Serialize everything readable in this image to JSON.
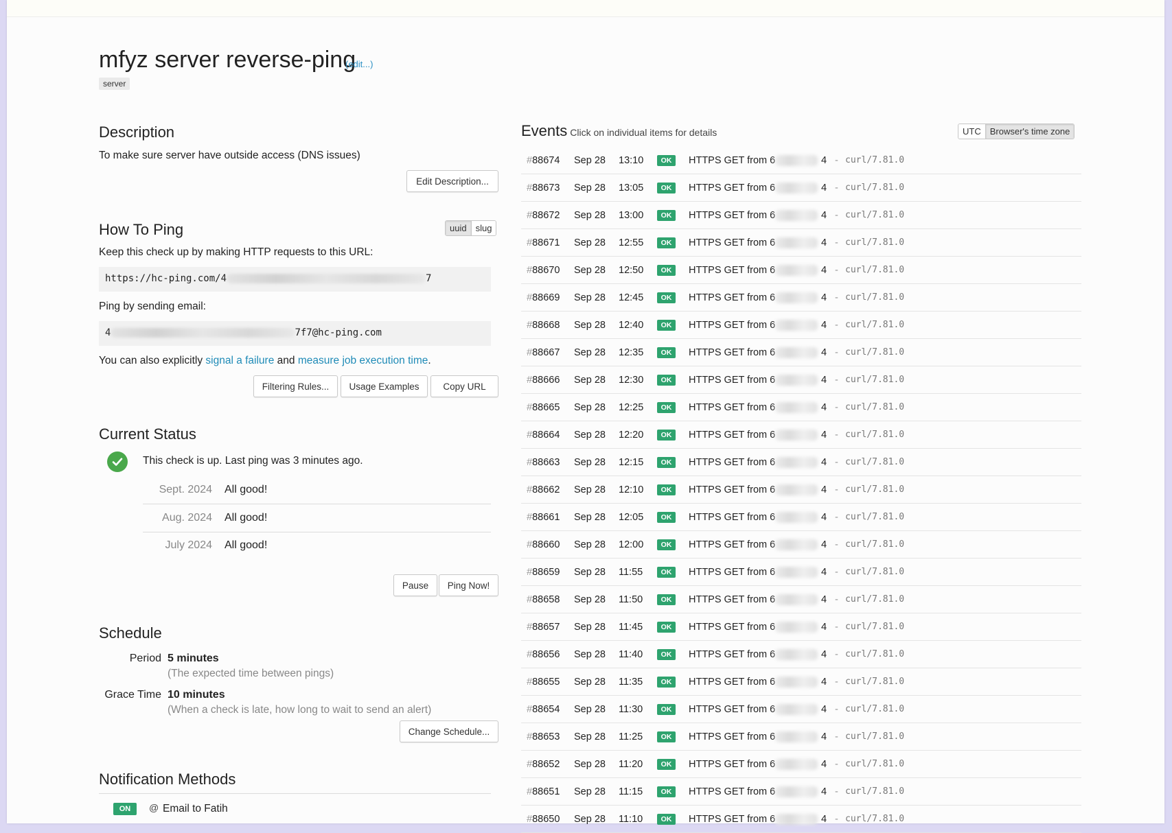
{
  "check": {
    "title": "mfyz server reverse-ping",
    "edit_label": "(edit...)",
    "tag": "server"
  },
  "description": {
    "heading": "Description",
    "text": "To make sure server have outside access (DNS issues)",
    "edit_button": "Edit Description..."
  },
  "how_to_ping": {
    "heading": "How To Ping",
    "toggle": [
      "uuid",
      "slug"
    ],
    "toggle_active": "uuid",
    "url_intro": "Keep this check up by making HTTP requests to this URL:",
    "url_prefix": "https://hc-ping.com/4",
    "url_suffix": "7",
    "email_intro": "Ping by sending email:",
    "email_prefix": "4",
    "email_suffix": "7f7@hc-ping.com",
    "extra_pre": "You can also explicitly ",
    "signal_link": "signal a failure",
    "extra_mid": " and ",
    "measure_link": "measure job execution time",
    "extra_post": ".",
    "buttons": [
      "Filtering Rules...",
      "Usage Examples",
      "Copy URL"
    ]
  },
  "current_status": {
    "heading": "Current Status",
    "status_text": "This check is up. Last ping was 3 minutes ago.",
    "months": [
      {
        "month": "Sept. 2024",
        "status": "All good!"
      },
      {
        "month": "Aug. 2024",
        "status": "All good!"
      },
      {
        "month": "July 2024",
        "status": "All good!"
      }
    ],
    "pause_button": "Pause",
    "ping_now_button": "Ping Now!"
  },
  "schedule": {
    "heading": "Schedule",
    "period_label": "Period",
    "period_value": "5 minutes",
    "period_note": "(The expected time between pings)",
    "grace_label": "Grace Time",
    "grace_value": "10 minutes",
    "grace_note": "(When a check is late, how long to wait to send an alert)",
    "change_button": "Change Schedule..."
  },
  "notifications": {
    "heading": "Notification Methods",
    "items": [
      {
        "state": "ON",
        "icon": "email-icon",
        "icon_glyph": "@",
        "label": "Email to Fatih"
      }
    ]
  },
  "events": {
    "heading": "Events",
    "subheading": "Click on individual items for details",
    "tz_options": [
      "UTC",
      "Browser's time zone"
    ],
    "tz_active": "Browser's time zone",
    "rows": [
      {
        "num": "88674",
        "date": "Sep 28",
        "time": "13:10",
        "status": "OK",
        "desc": "HTTPS GET from 6",
        "ip_end": "4",
        "sep": "-",
        "ua": "curl/7.81.0"
      },
      {
        "num": "88673",
        "date": "Sep 28",
        "time": "13:05",
        "status": "OK",
        "desc": "HTTPS GET from 6",
        "ip_end": "4",
        "sep": "-",
        "ua": "curl/7.81.0"
      },
      {
        "num": "88672",
        "date": "Sep 28",
        "time": "13:00",
        "status": "OK",
        "desc": "HTTPS GET from 6",
        "ip_end": "4",
        "sep": "-",
        "ua": "curl/7.81.0"
      },
      {
        "num": "88671",
        "date": "Sep 28",
        "time": "12:55",
        "status": "OK",
        "desc": "HTTPS GET from 6",
        "ip_end": "4",
        "sep": "-",
        "ua": "curl/7.81.0"
      },
      {
        "num": "88670",
        "date": "Sep 28",
        "time": "12:50",
        "status": "OK",
        "desc": "HTTPS GET from 6",
        "ip_end": "4",
        "sep": "-",
        "ua": "curl/7.81.0"
      },
      {
        "num": "88669",
        "date": "Sep 28",
        "time": "12:45",
        "status": "OK",
        "desc": "HTTPS GET from 6",
        "ip_end": "4",
        "sep": "-",
        "ua": "curl/7.81.0"
      },
      {
        "num": "88668",
        "date": "Sep 28",
        "time": "12:40",
        "status": "OK",
        "desc": "HTTPS GET from 6",
        "ip_end": "4",
        "sep": "-",
        "ua": "curl/7.81.0"
      },
      {
        "num": "88667",
        "date": "Sep 28",
        "time": "12:35",
        "status": "OK",
        "desc": "HTTPS GET from 6",
        "ip_end": "4",
        "sep": "-",
        "ua": "curl/7.81.0"
      },
      {
        "num": "88666",
        "date": "Sep 28",
        "time": "12:30",
        "status": "OK",
        "desc": "HTTPS GET from 6",
        "ip_end": "4",
        "sep": "-",
        "ua": "curl/7.81.0"
      },
      {
        "num": "88665",
        "date": "Sep 28",
        "time": "12:25",
        "status": "OK",
        "desc": "HTTPS GET from 6",
        "ip_end": "4",
        "sep": "-",
        "ua": "curl/7.81.0"
      },
      {
        "num": "88664",
        "date": "Sep 28",
        "time": "12:20",
        "status": "OK",
        "desc": "HTTPS GET from 6",
        "ip_end": "4",
        "sep": "-",
        "ua": "curl/7.81.0"
      },
      {
        "num": "88663",
        "date": "Sep 28",
        "time": "12:15",
        "status": "OK",
        "desc": "HTTPS GET from 6",
        "ip_end": "4",
        "sep": "-",
        "ua": "curl/7.81.0"
      },
      {
        "num": "88662",
        "date": "Sep 28",
        "time": "12:10",
        "status": "OK",
        "desc": "HTTPS GET from 6",
        "ip_end": "4",
        "sep": "-",
        "ua": "curl/7.81.0"
      },
      {
        "num": "88661",
        "date": "Sep 28",
        "time": "12:05",
        "status": "OK",
        "desc": "HTTPS GET from 6",
        "ip_end": "4",
        "sep": "-",
        "ua": "curl/7.81.0"
      },
      {
        "num": "88660",
        "date": "Sep 28",
        "time": "12:00",
        "status": "OK",
        "desc": "HTTPS GET from 6",
        "ip_end": "4",
        "sep": "-",
        "ua": "curl/7.81.0"
      },
      {
        "num": "88659",
        "date": "Sep 28",
        "time": "11:55",
        "status": "OK",
        "desc": "HTTPS GET from 6",
        "ip_end": "4",
        "sep": "-",
        "ua": "curl/7.81.0"
      },
      {
        "num": "88658",
        "date": "Sep 28",
        "time": "11:50",
        "status": "OK",
        "desc": "HTTPS GET from 6",
        "ip_end": "4",
        "sep": "-",
        "ua": "curl/7.81.0"
      },
      {
        "num": "88657",
        "date": "Sep 28",
        "time": "11:45",
        "status": "OK",
        "desc": "HTTPS GET from 6",
        "ip_end": "4",
        "sep": "-",
        "ua": "curl/7.81.0"
      },
      {
        "num": "88656",
        "date": "Sep 28",
        "time": "11:40",
        "status": "OK",
        "desc": "HTTPS GET from 6",
        "ip_end": "4",
        "sep": "-",
        "ua": "curl/7.81.0"
      },
      {
        "num": "88655",
        "date": "Sep 28",
        "time": "11:35",
        "status": "OK",
        "desc": "HTTPS GET from 6",
        "ip_end": "4",
        "sep": "-",
        "ua": "curl/7.81.0"
      },
      {
        "num": "88654",
        "date": "Sep 28",
        "time": "11:30",
        "status": "OK",
        "desc": "HTTPS GET from 6",
        "ip_end": "4",
        "sep": "-",
        "ua": "curl/7.81.0"
      },
      {
        "num": "88653",
        "date": "Sep 28",
        "time": "11:25",
        "status": "OK",
        "desc": "HTTPS GET from 6",
        "ip_end": "4",
        "sep": "-",
        "ua": "curl/7.81.0"
      },
      {
        "num": "88652",
        "date": "Sep 28",
        "time": "11:20",
        "status": "OK",
        "desc": "HTTPS GET from 6",
        "ip_end": "4",
        "sep": "-",
        "ua": "curl/7.81.0"
      },
      {
        "num": "88651",
        "date": "Sep 28",
        "time": "11:15",
        "status": "OK",
        "desc": "HTTPS GET from 6",
        "ip_end": "4",
        "sep": "-",
        "ua": "curl/7.81.0"
      },
      {
        "num": "88650",
        "date": "Sep 28",
        "time": "11:10",
        "status": "OK",
        "desc": "HTTPS GET from 6",
        "ip_end": "4",
        "sep": "-",
        "ua": "curl/7.81.0"
      }
    ]
  },
  "colors": {
    "accent_link": "#1f8bb7",
    "ok_green": "#2ea36e",
    "status_green": "#4aa84b",
    "page_background": "#fcfcfc",
    "outer_background": "#dcd8f3"
  }
}
